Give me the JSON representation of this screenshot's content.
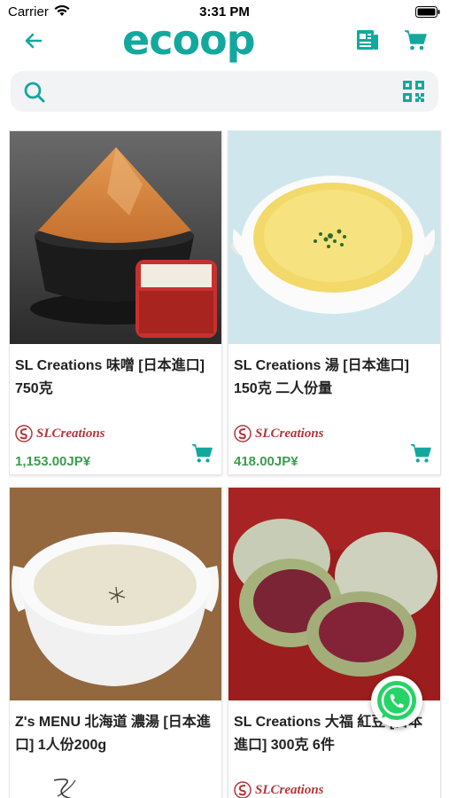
{
  "status_bar": {
    "carrier": "Carrier",
    "time": "3:31 PM"
  },
  "header": {
    "logo": "ecoop"
  },
  "search": {
    "placeholder": ""
  },
  "colors": {
    "accent": "#13a89e",
    "price": "#3a9c4e",
    "brand": "#b0373a"
  },
  "products": [
    {
      "name": "SL Creations 味噌 [日本進口] 750克",
      "brand": "SLCreations",
      "price": "1,153.00JP¥"
    },
    {
      "name": "SL Creations 湯 [日本進口] 150克 二人份量",
      "brand": "SLCreations",
      "price": "418.00JP¥"
    },
    {
      "name": "Z's MENU 北海道 濃湯 [日本進口] 1人份200g",
      "brand": "",
      "price": ""
    },
    {
      "name": "SL Creations 大福 紅豆 [日本進口] 300克 6件",
      "brand": "SLCreations",
      "price": ""
    }
  ],
  "icons": {
    "back": "back-arrow-icon",
    "news": "news-icon",
    "cart": "cart-icon",
    "search": "search-icon",
    "qr": "qr-code-icon",
    "whatsapp": "whatsapp-icon"
  }
}
